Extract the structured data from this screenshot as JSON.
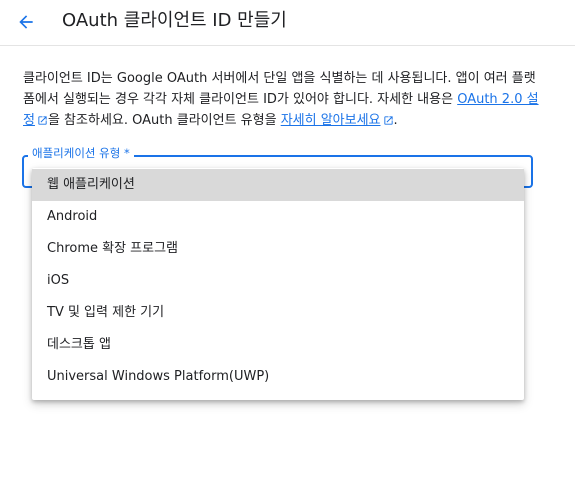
{
  "header": {
    "title": "OAuth 클라이언트 ID 만들기",
    "back_icon": "arrow-back-icon"
  },
  "description": {
    "text1": "클라이언트 ID는 Google OAuth 서버에서 단일 앱을 식별하는 데 사용됩니다. 앱이 여러 플랫폼에서 실행되는 경우 각각 자체 클라이언트 ID가 있어야 합니다. 자세한 내용은 ",
    "link1": "OAuth 2.0 설정",
    "text2": "을 참조하세요. OAuth 클라이언트 유형을 ",
    "link2": "자세히 알아보세요",
    "text3": "."
  },
  "app_type_field": {
    "label": "애플리케이션 유형 *",
    "selected": "웹 애플리케이션",
    "options": [
      "웹 애플리케이션",
      "Android",
      "Chrome 확장 프로그램",
      "iOS",
      "TV 및 입력 제한 기기",
      "데스크톱 앱",
      "Universal Windows Platform(UWP)"
    ]
  },
  "colors": {
    "accent": "#1a73e8",
    "selected_bg": "#d9d9d9"
  }
}
